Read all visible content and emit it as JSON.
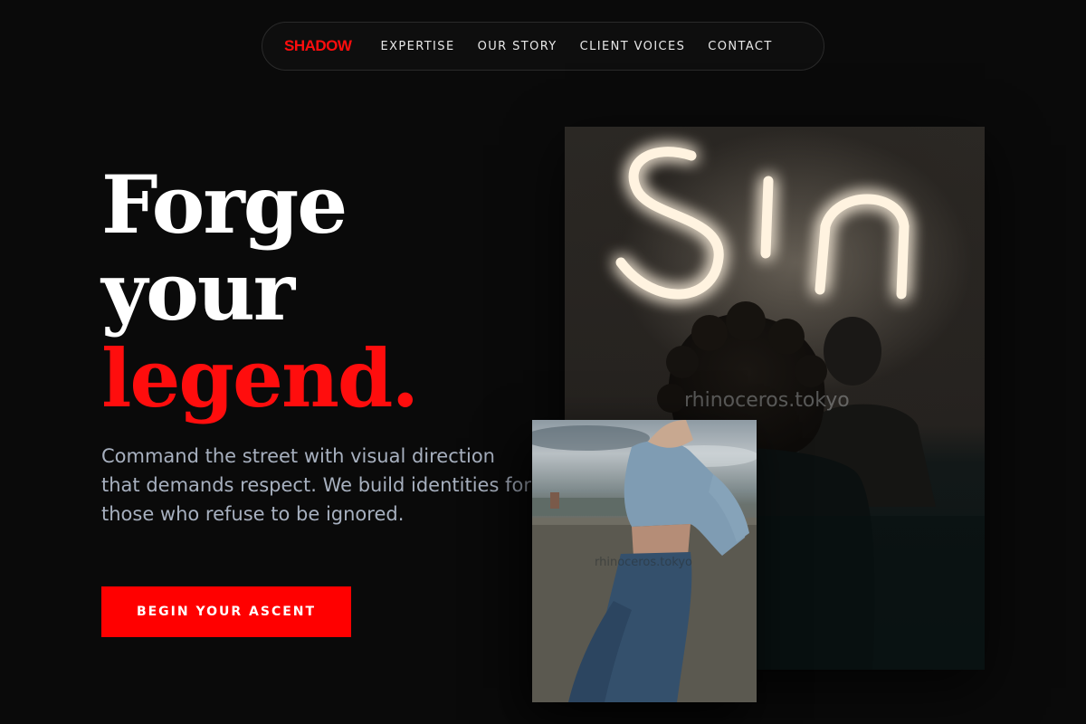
{
  "nav": {
    "brand": "SHADOW",
    "links": [
      "EXPERTISE",
      "OUR STORY",
      "CLIENT VOICES",
      "CONTACT"
    ]
  },
  "hero": {
    "headline_line1": "Forge",
    "headline_line2": "your",
    "headline_line3": "legend.",
    "subtitle": "Command the street with visual direction that demands respect. We build identities for those who refuse to be ignored.",
    "cta_label": "BEGIN YOUR ASCENT"
  },
  "images": {
    "neon_sign_text": "Sin",
    "watermark_main": "rhinoceros.tokyo",
    "watermark_secondary": "rhinoceros.tokyo"
  },
  "colors": {
    "background": "#0a0a0a",
    "accent": "#ff0d0d",
    "cta": "#ff0000",
    "subtitle": "#a7b0bf"
  }
}
